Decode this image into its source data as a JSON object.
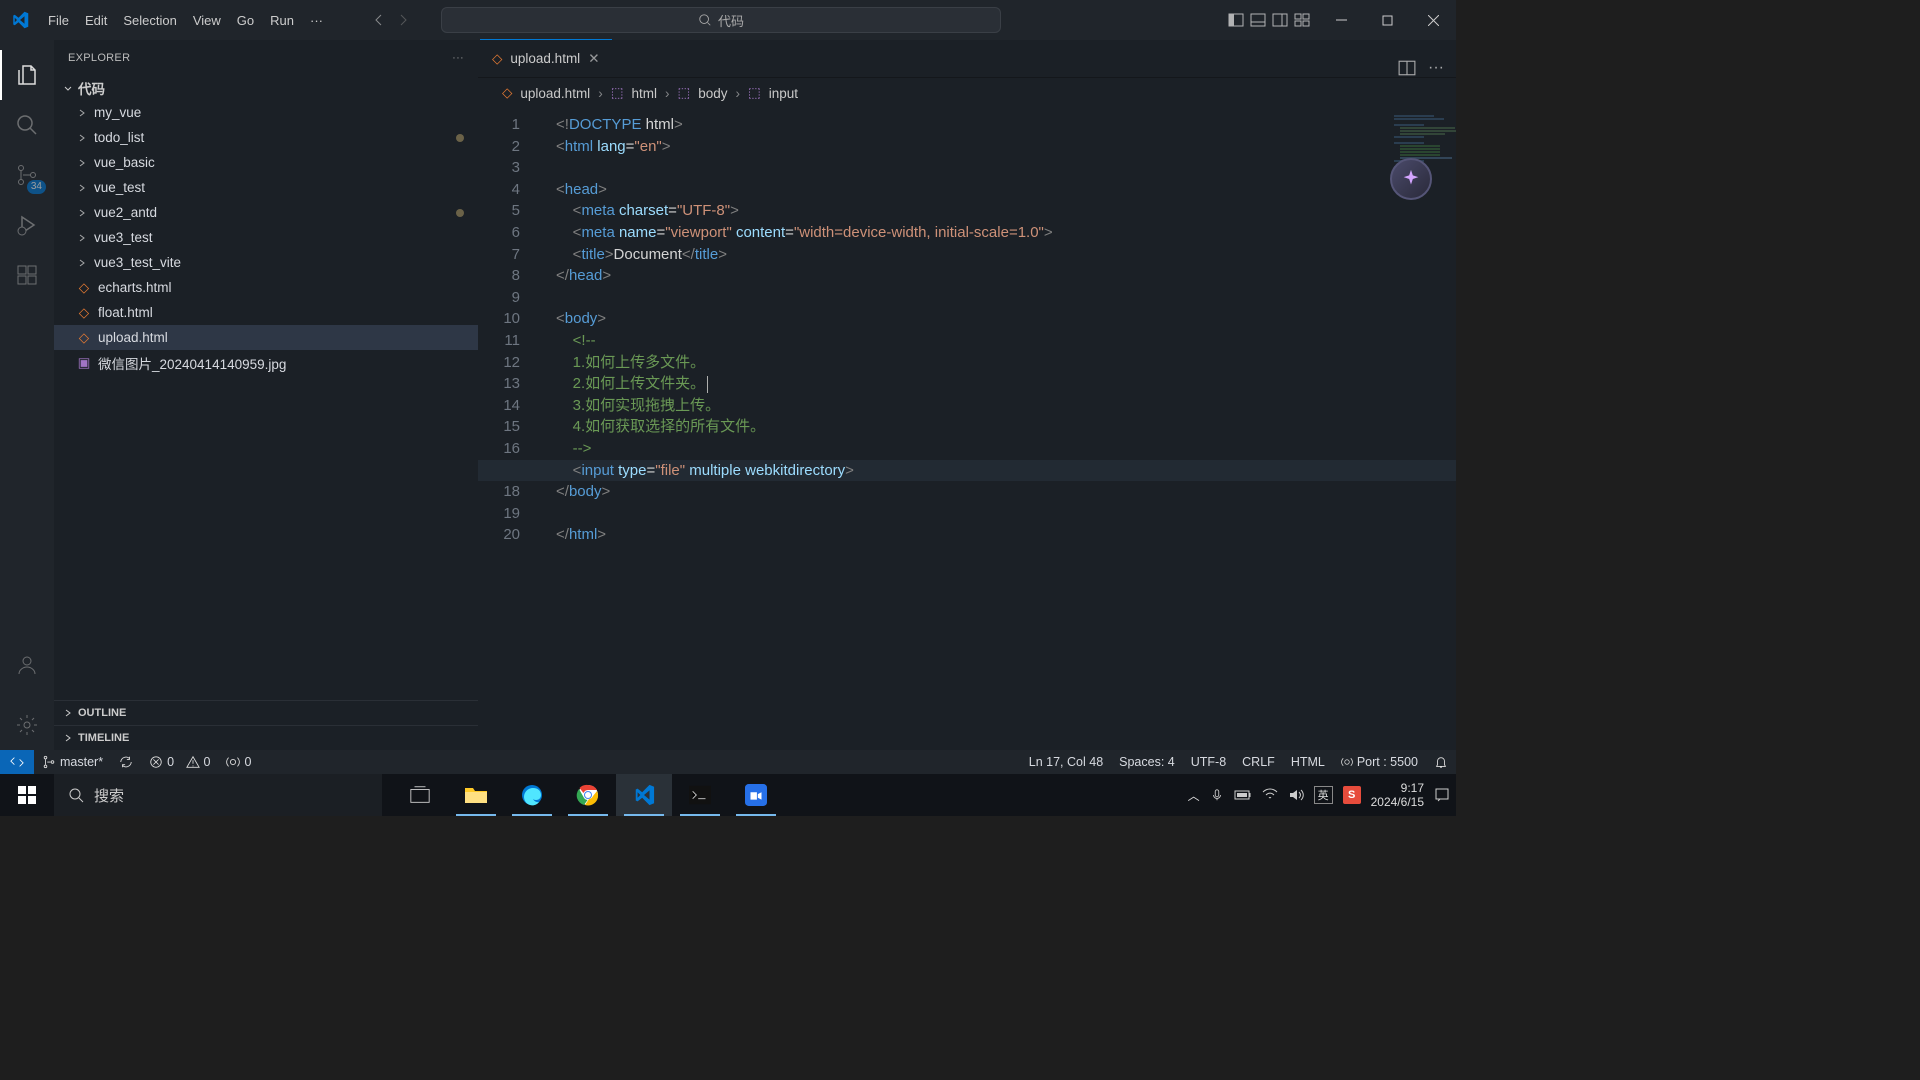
{
  "menu": {
    "file": "File",
    "edit": "Edit",
    "selection": "Selection",
    "view": "View",
    "go": "Go",
    "run": "Run"
  },
  "search_placeholder": "代码",
  "explorer": {
    "title": "EXPLORER",
    "root": "代码",
    "outline": "OUTLINE",
    "timeline": "TIMELINE"
  },
  "tree": [
    {
      "name": "my_vue",
      "type": "folder"
    },
    {
      "name": "todo_list",
      "type": "folder",
      "modified": true
    },
    {
      "name": "vue_basic",
      "type": "folder"
    },
    {
      "name": "vue_test",
      "type": "folder"
    },
    {
      "name": "vue2_antd",
      "type": "folder",
      "modified": true
    },
    {
      "name": "vue3_test",
      "type": "folder"
    },
    {
      "name": "vue3_test_vite",
      "type": "folder"
    },
    {
      "name": "echarts.html",
      "type": "html"
    },
    {
      "name": "float.html",
      "type": "html"
    },
    {
      "name": "upload.html",
      "type": "html",
      "selected": true
    },
    {
      "name": "微信图片_20240414140959.jpg",
      "type": "img"
    }
  ],
  "tab": {
    "name": "upload.html"
  },
  "crumbs": {
    "file": "upload.html",
    "p1": "html",
    "p2": "body",
    "p3": "input"
  },
  "scm_badge": "34",
  "code": {
    "l1": {
      "doctype": "DOCTYPE",
      "html": "html"
    },
    "l2": {
      "tag": "html",
      "attr": "lang",
      "val": "\"en\""
    },
    "l4": {
      "tag": "head"
    },
    "l5": {
      "tag": "meta",
      "attr": "charset",
      "val": "\"UTF-8\""
    },
    "l6": {
      "tag": "meta",
      "a1": "name",
      "v1": "\"viewport\"",
      "a2": "content",
      "v2": "\"width=device-width, initial-scale=1.0\""
    },
    "l7": {
      "tag": "title",
      "text": "Document"
    },
    "l8": {
      "tag": "head"
    },
    "l10": {
      "tag": "body"
    },
    "l11": "<!-- ",
    "l12": "    1.如何上传多文件。",
    "l13": "    2.如何上传文件夹。",
    "l14": "    3.如何实现拖拽上传。",
    "l15": "    4.如何获取选择的所有文件。",
    "l16": "    -->",
    "l17": {
      "tag": "input",
      "a1": "type",
      "v1": "\"file\"",
      "a2": "multiple",
      "a3": "webkitdirectory"
    },
    "l18": {
      "tag": "body"
    },
    "l20": {
      "tag": "html"
    }
  },
  "status": {
    "branch": "master*",
    "errors": "0",
    "warnings": "0",
    "ports": "0",
    "pos": "Ln 17, Col 48",
    "spaces": "Spaces: 4",
    "enc": "UTF-8",
    "eol": "CRLF",
    "lang": "HTML",
    "live": "Port : 5500"
  },
  "taskbar": {
    "search": "搜索",
    "time": "9:17",
    "date": "2024/6/15",
    "ime": "英"
  }
}
